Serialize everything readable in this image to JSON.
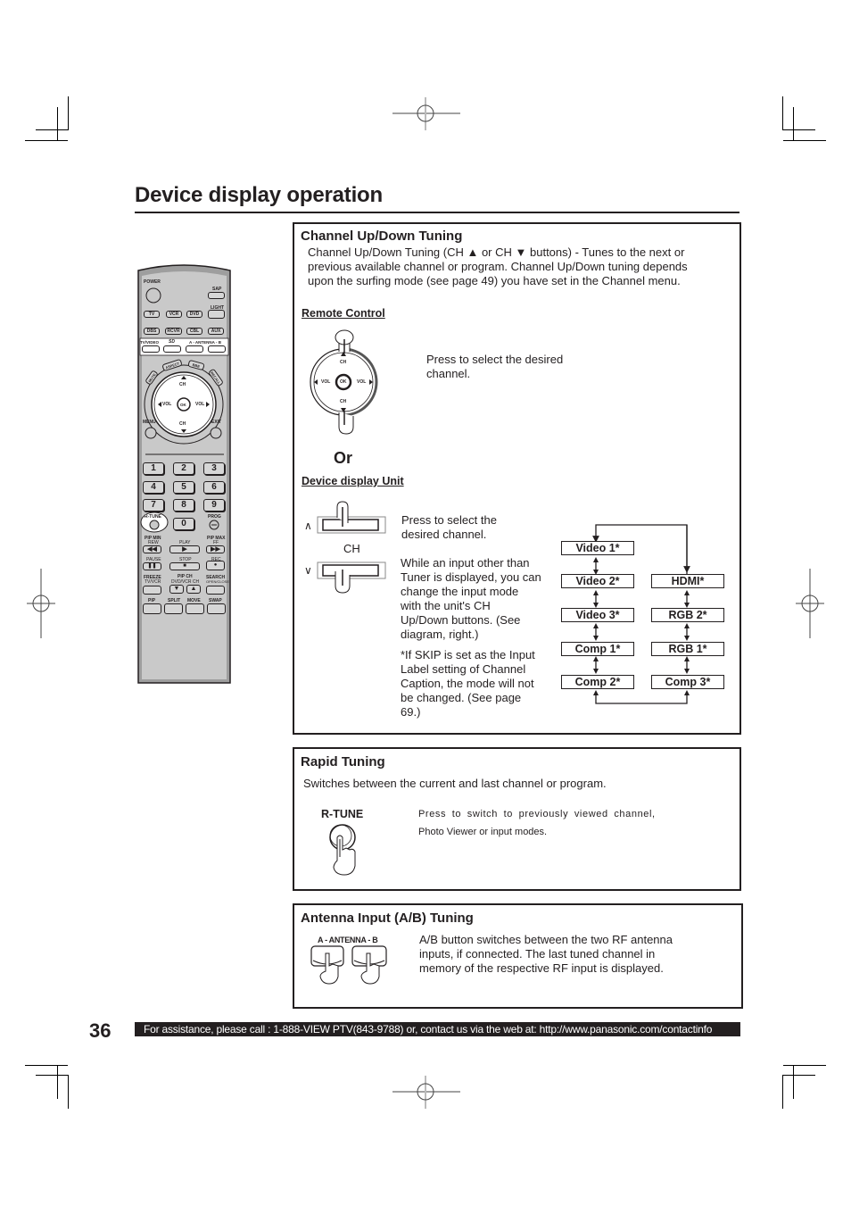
{
  "page": {
    "title": "Device display operation",
    "page_number": "36",
    "footer": "For assistance, please call : 1-888-VIEW PTV(843-9788) or, contact us via the web at: http://www.panasonic.com/contactinfo"
  },
  "remote": {
    "power": "POWER",
    "sap": "SAP",
    "light": "LIGHT",
    "row1": [
      "TV",
      "VCR",
      "DVD"
    ],
    "row2": [
      "DBS",
      "RCVR",
      "CBL",
      "AUX"
    ],
    "tv_video": "TV/VIDEO",
    "sd_icon": "SD",
    "antenna": "A - ANTENNA - B",
    "arc_buttons": [
      "MUTE",
      "ASPECT",
      "BBE",
      "RECALL"
    ],
    "ch": "CH",
    "vol": "VOL",
    "ok": "OK",
    "menu": "MENU",
    "exit": "EXIT",
    "numbers": [
      "1",
      "2",
      "3",
      "4",
      "5",
      "6",
      "7",
      "8",
      "9",
      "0"
    ],
    "rtune": "R-TUNE",
    "prog": "PROG",
    "pip_min": "PIP MIN",
    "pip_max": "PIP MAX",
    "rew": "REW",
    "play": "PLAY",
    "ff": "FF",
    "pause": "PAUSE",
    "stop": "STOP",
    "rec": "REC",
    "freeze": "FREEZE",
    "tv_vcr": "TV/VCR",
    "pip_ch": "PIP CH",
    "dvd_vcr_ch": "DVD/VCR CH",
    "search": "SEARCH",
    "open_close": "OPEN/CLOSE",
    "bottom": [
      "PIP",
      "SPLIT",
      "MOVE",
      "SWAP"
    ]
  },
  "channel_section": {
    "title": "Channel Up/Down Tuning",
    "description": [
      "Channel Up/Down Tuning (CH ▲ or CH ▼ buttons) - Tunes to the next or",
      "previous available channel or program. Channel Up/Down tuning depends",
      "upon the surfing mode (see page 49) you have set in the Channel menu."
    ],
    "remote_control_label": "Remote Control",
    "remote_press_text": [
      "Press to select the desired",
      "channel."
    ],
    "dial": {
      "ch": "CH",
      "vol": "VOL",
      "ok": "OK"
    },
    "or_label": "Or",
    "device_unit_label": "Device display Unit",
    "unit_ch_label": "CH",
    "unit_up_symbol": "∧",
    "unit_down_symbol": "∨",
    "unit_press_text": [
      "Press to select the",
      "desired channel."
    ],
    "unit_note": [
      "While an input other than",
      "Tuner is displayed, you can",
      "change the input mode",
      "with the unit's CH",
      "Up/Down buttons. (See",
      "diagram, right.)"
    ],
    "skip_note": [
      "*If SKIP is set as the Input",
      "Label setting of Channel",
      "Caption, the mode will not",
      "be changed. (See page",
      "69.)"
    ],
    "flow_left": [
      "Video 1*",
      "Video 2*",
      "Video 3*",
      "Comp 1*",
      "Comp 2*"
    ],
    "flow_right": [
      "HDMI*",
      "RGB 2*",
      "RGB 1*",
      "Comp 3*"
    ]
  },
  "rapid_section": {
    "title": "Rapid Tuning",
    "description": "Switches between the current and last channel or program.",
    "button_label": "R-TUNE",
    "press_text": [
      "Press to switch to previously viewed channel,",
      "Photo Viewer or input modes."
    ]
  },
  "antenna_section": {
    "title": "Antenna Input (A/B) Tuning",
    "button_label": "A - ANTENNA - B",
    "text": [
      "A/B button switches between the two RF antenna",
      "inputs, if connected. The last tuned channel in",
      "memory of the respective RF input is displayed."
    ]
  }
}
